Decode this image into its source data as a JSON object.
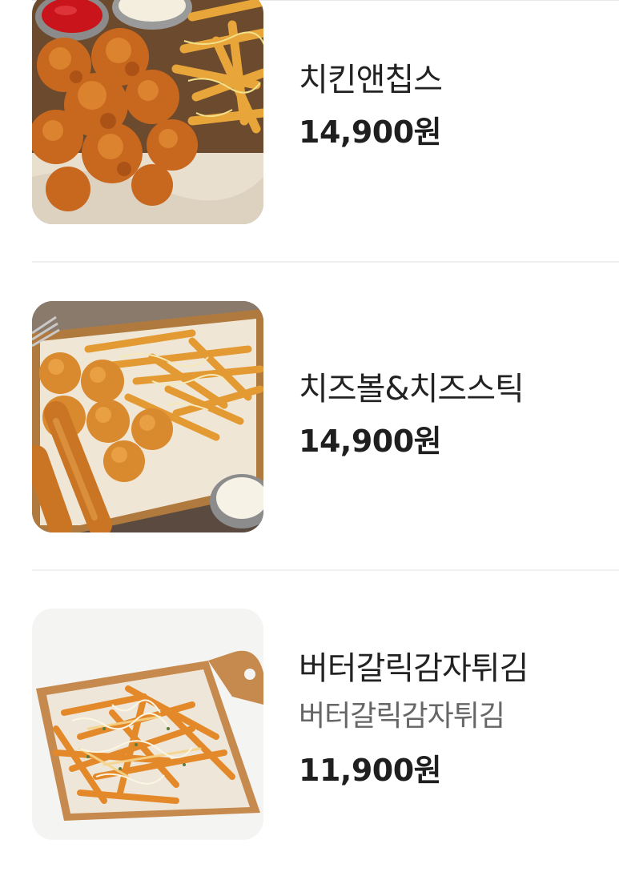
{
  "menu": {
    "items": [
      {
        "name": "치킨앤칩스",
        "price": "14,900원",
        "image": "chicken-and-chips-photo"
      },
      {
        "name": "치즈볼&치즈스틱",
        "price": "14,900원",
        "image": "cheeseball-and-cheesestick-photo"
      },
      {
        "name": "버터갈릭감자튀김",
        "description": "버터갈릭감자튀김",
        "price": "11,900원",
        "image": "butter-garlic-fries-photo"
      }
    ]
  },
  "colors": {
    "text_primary": "#222222",
    "text_secondary": "#666666",
    "divider": "#f0f0f0",
    "background": "#ffffff"
  }
}
